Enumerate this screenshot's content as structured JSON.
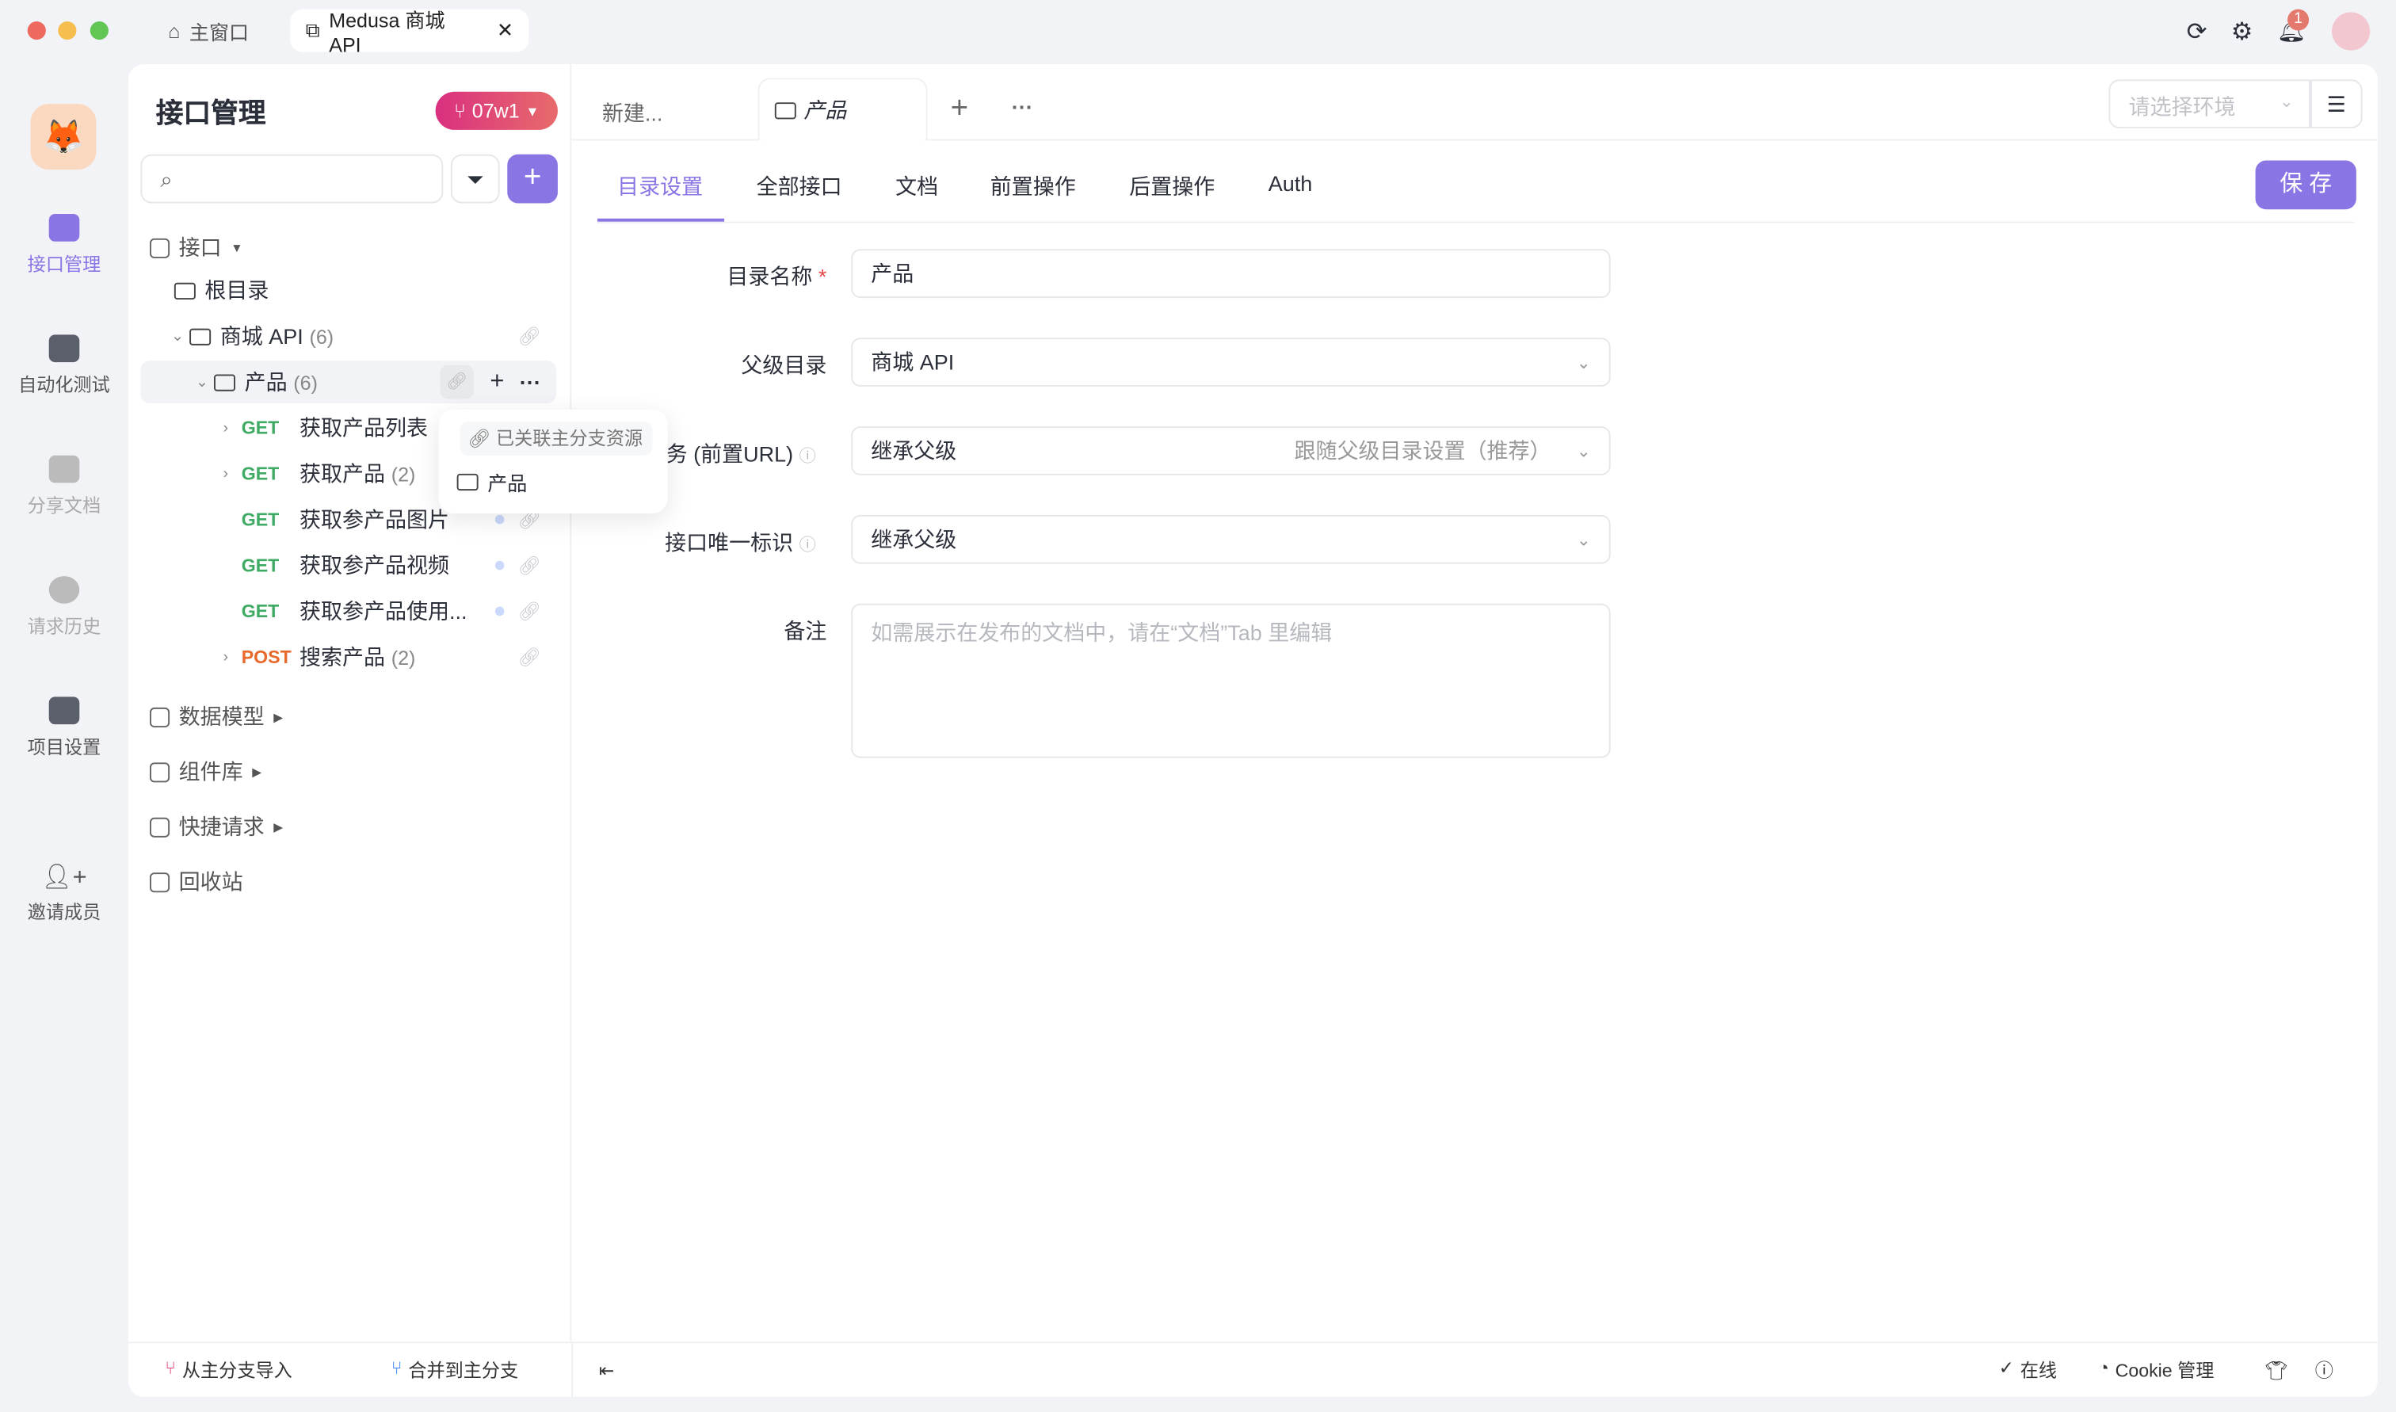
{
  "titlebar": {
    "tabs": [
      {
        "label": "主窗口",
        "icon": "home-icon"
      },
      {
        "label": "Medusa 商城 API",
        "icon": "external-icon"
      }
    ],
    "notification_count": "1"
  },
  "rail": {
    "items": [
      {
        "label": "接口管理",
        "active": true
      },
      {
        "label": "自动化测试"
      },
      {
        "label": "分享文档",
        "disabled": true
      },
      {
        "label": "请求历史",
        "disabled": true
      },
      {
        "label": "项目设置"
      },
      {
        "label": "邀请成员"
      }
    ]
  },
  "sidebar": {
    "title": "接口管理",
    "branch": "07w1",
    "search_placeholder": "",
    "sections": {
      "api": "接口",
      "models": "数据模型",
      "components": "组件库",
      "quick": "快捷请求",
      "trash": "回收站"
    },
    "tree": {
      "root": "根目录",
      "shop": {
        "name": "商城 API",
        "count": "(6)"
      },
      "product": {
        "name": "产品",
        "count": "(6)"
      },
      "items": [
        {
          "method": "GET",
          "name": "获取产品列表",
          "count": ""
        },
        {
          "method": "GET",
          "name": "获取产品",
          "count": "(2)"
        },
        {
          "method": "GET",
          "name": "获取参产品图片",
          "count": ""
        },
        {
          "method": "GET",
          "name": "获取参产品视频",
          "count": ""
        },
        {
          "method": "GET",
          "name": "获取参产品使用...",
          "count": ""
        },
        {
          "method": "POST",
          "name": "搜索产品",
          "count": "(2)"
        }
      ]
    },
    "popover": {
      "header": "已关联主分支资源",
      "item": "产品"
    },
    "footer": {
      "import": "从主分支导入",
      "merge": "合并到主分支"
    }
  },
  "main": {
    "doc_tabs": [
      {
        "label": "新建..."
      },
      {
        "label": "产品"
      }
    ],
    "env_placeholder": "请选择环境",
    "sub_tabs": [
      "目录设置",
      "全部接口",
      "文档",
      "前置操作",
      "后置操作",
      "Auth"
    ],
    "save": "保 存",
    "form": {
      "name_label": "目录名称",
      "name_value": "产品",
      "parent_label": "父级目录",
      "parent_value": "商城 API",
      "service_label": "务 (前置URL)",
      "service_value": "继承父级",
      "service_hint": "跟随父级目录设置（推荐）",
      "uid_label": "接口唯一标识",
      "uid_value": "继承父级",
      "note_label": "备注",
      "note_placeholder": "如需展示在发布的文档中，请在“文档”Tab 里编辑"
    }
  },
  "status": {
    "online": "在线",
    "cookie": "Cookie 管理"
  },
  "colors": {
    "accent": "#8b74e4",
    "get": "#3eaa63",
    "post": "#e7692c",
    "branch": "#e0457b"
  }
}
